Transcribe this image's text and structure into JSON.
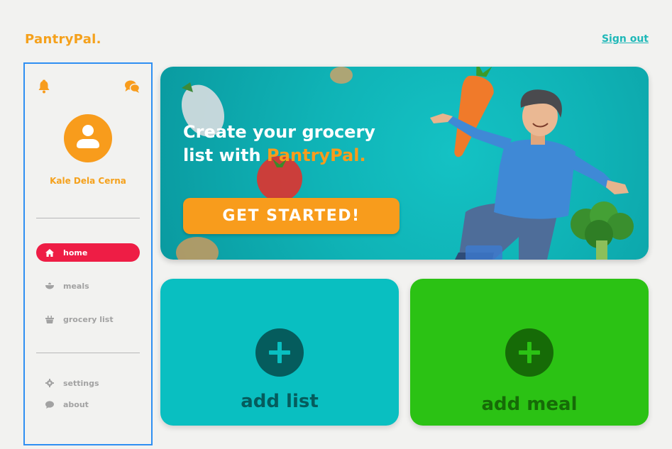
{
  "header": {
    "brand": "PantryPal.",
    "sign_out": "Sign out"
  },
  "sidebar": {
    "icons": [
      "bell-icon",
      "chat-icon"
    ],
    "user_name": "Kale Dela Cerna",
    "nav": [
      {
        "label": "home",
        "icon": "home-icon",
        "active": true
      },
      {
        "label": "meals",
        "icon": "bowl-icon",
        "active": false
      },
      {
        "label": "grocery list",
        "icon": "basket-icon",
        "active": false
      }
    ],
    "footer_nav": [
      {
        "label": "settings",
        "icon": "gear-icon"
      },
      {
        "label": "about",
        "icon": "speech-icon"
      }
    ]
  },
  "banner": {
    "title_line1": "Create your grocery",
    "title_line2_prefix": "list with ",
    "title_highlight": "PantryPal.",
    "cta": "GET STARTED!"
  },
  "cards": {
    "add_list": "add list",
    "add_meal": "add meal"
  },
  "colors": {
    "brand_orange": "#f89c1c",
    "teal": "#09bfc1",
    "green": "#2bc214",
    "active_red": "#ee1d45",
    "sidebar_border": "#2f8ff2"
  }
}
